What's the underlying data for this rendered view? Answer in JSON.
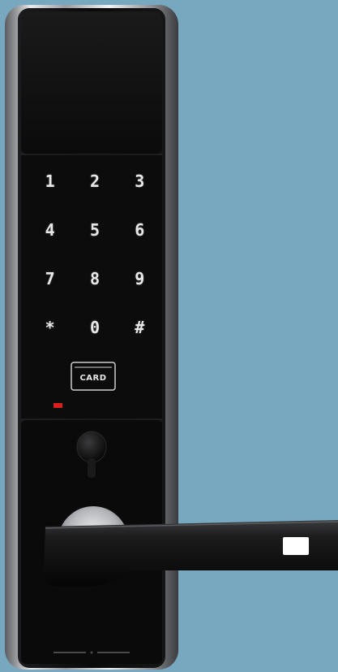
{
  "scene": {
    "background_color": "#78a8c0",
    "lock_body_color": "#0d0d0e",
    "chrome_color": "#c9cbce",
    "indicator_color": "#d8201c"
  },
  "keypad": {
    "keys": [
      "1",
      "2",
      "3",
      "4",
      "5",
      "6",
      "7",
      "8",
      "9",
      "*",
      "0",
      "#"
    ]
  },
  "card_reader": {
    "label": "CARD"
  }
}
